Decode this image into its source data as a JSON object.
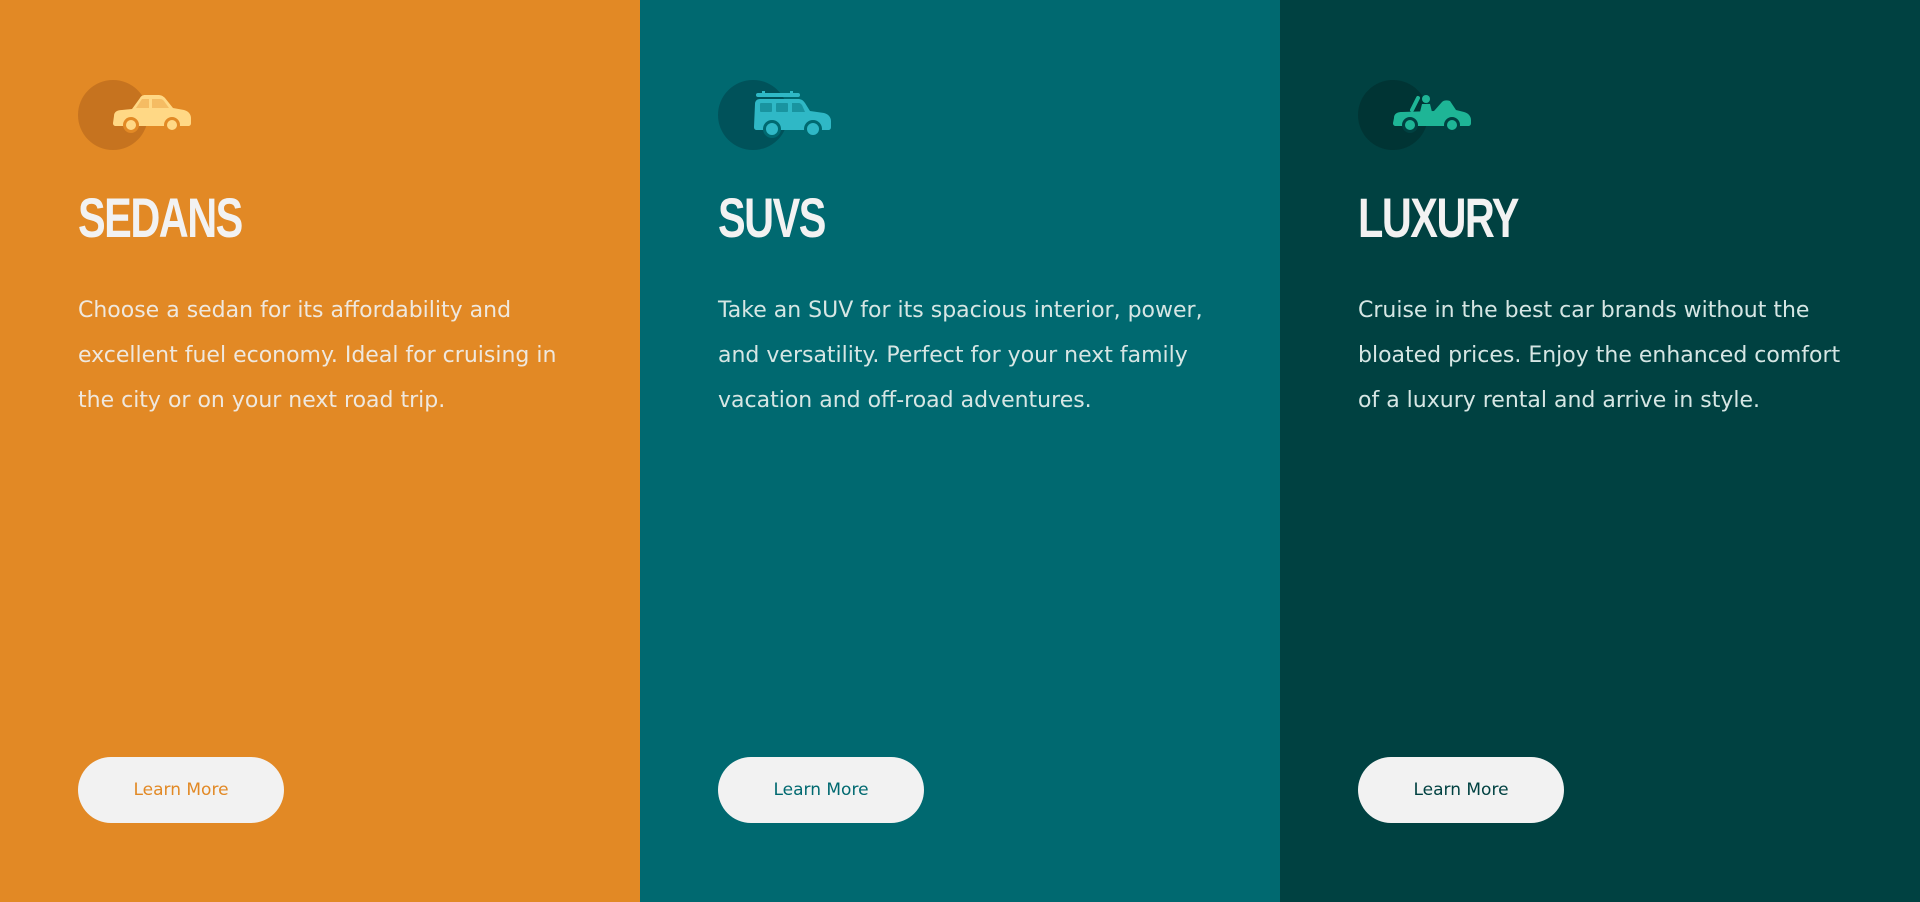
{
  "colors": {
    "sedan_bg": "#E28925",
    "suv_bg": "#006970",
    "luxury_bg": "#004141",
    "button_bg": "#F2F2F2",
    "sedan_icon": "#FFD885",
    "suv_icon": "#2FB8C6",
    "luxury_icon": "#1EB596",
    "heading_text": "#F2F2F2"
  },
  "cards": [
    {
      "icon": "sedan-car-icon",
      "title": "SEDANS",
      "description": "Choose a sedan for its affordability and excellent fuel economy. Ideal for cruising in the city or on your next road trip.",
      "button_label": "Learn More"
    },
    {
      "icon": "suv-car-icon",
      "title": "SUVS",
      "description": "Take an SUV for its spacious interior, power, and versatility. Perfect for your next family vacation and off-road adventures.",
      "button_label": "Learn More"
    },
    {
      "icon": "luxury-convertible-icon",
      "title": "LUXURY",
      "description": "Cruise in the best car brands without the bloated prices. Enjoy the enhanced comfort of a luxury rental and arrive in style.",
      "button_label": "Learn More"
    }
  ]
}
